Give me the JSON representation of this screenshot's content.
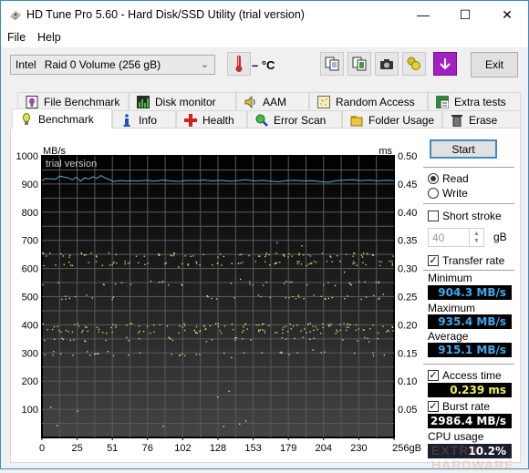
{
  "window": {
    "title": "HD Tune Pro 5.60 - Hard Disk/SSD Utility (trial version)",
    "controls": {
      "minimize": "—",
      "maximize": "☐",
      "close": "✕"
    }
  },
  "menu": {
    "items": [
      "File",
      "Help"
    ]
  },
  "toolbar": {
    "drive_vendor": "Intel",
    "drive_name": "Raid 0 Volume (256 gB)",
    "temperature": "– °C",
    "exit_label": "Exit",
    "icons": [
      "copy-text-icon",
      "copy-screen-icon",
      "screenshot-camera-icon",
      "options-coins-icon",
      "save-download-icon"
    ]
  },
  "tabs": {
    "row1": [
      "File Benchmark",
      "Disk monitor",
      "AAM",
      "Random Access",
      "Extra tests"
    ],
    "row2": [
      "Benchmark",
      "Info",
      "Health",
      "Error Scan",
      "Folder Usage",
      "Erase"
    ],
    "active": "Benchmark"
  },
  "controls": {
    "start_label": "Start",
    "mode_options": [
      "Read",
      "Write"
    ],
    "mode_selected": "Read",
    "short_stroke_label": "Short stroke",
    "short_stroke_checked": false,
    "short_stroke_value": "40",
    "short_stroke_unit": "gB",
    "transfer_rate_label": "Transfer rate",
    "transfer_rate_checked": true,
    "access_time_label": "Access time",
    "access_time_checked": true,
    "burst_rate_label": "Burst rate",
    "burst_rate_checked": true
  },
  "results": {
    "minimum_label": "Minimum",
    "minimum": "904.3 MB/s",
    "maximum_label": "Maximum",
    "maximum": "935.4 MB/s",
    "average_label": "Average",
    "average": "915.1 MB/s",
    "access_time": "0.239 ms",
    "burst_rate": "2986.4 MB/s",
    "cpu_usage_label": "CPU usage",
    "cpu_usage": "10.2%",
    "colors": {
      "transfer": "#4aa8e0",
      "access": "#f0f060",
      "burst": "#ffffff"
    }
  },
  "watermark": "EXTRA HARDWARE",
  "chart_data": {
    "type": "line",
    "title": "",
    "watermark_text": "trial version",
    "xlabel": "gB",
    "ylabel_left": "MB/s",
    "ylabel_right": "ms",
    "x_ticks": [
      "0",
      "25",
      "51",
      "76",
      "102",
      "128",
      "153",
      "179",
      "204",
      "230",
      "256gB"
    ],
    "xlim": [
      0,
      256
    ],
    "y_left_ticks": [
      "1000",
      "900",
      "800",
      "700",
      "600",
      "500",
      "400",
      "300",
      "200",
      "100"
    ],
    "ylim_left": [
      0,
      1000
    ],
    "y_right_ticks": [
      "0.50",
      "0.45",
      "0.40",
      "0.35",
      "0.30",
      "0.25",
      "0.20",
      "0.15",
      "0.10",
      "0.05"
    ],
    "ylim_right": [
      0,
      0.5
    ],
    "grid": true,
    "series": [
      {
        "name": "Transfer rate",
        "kind": "line",
        "x": [
          0,
          3,
          6,
          10,
          13,
          16,
          19,
          22,
          25,
          28,
          31,
          34,
          37,
          40,
          43,
          46,
          49,
          52,
          55,
          58,
          61,
          64,
          70,
          76,
          82,
          88,
          94,
          100,
          106,
          112,
          118,
          124,
          130,
          136,
          142,
          148,
          154,
          160,
          166,
          172,
          178,
          184,
          190,
          196,
          202,
          208,
          214,
          220,
          226,
          232,
          238,
          244,
          250,
          256
        ],
        "values": [
          912,
          920,
          918,
          917,
          928,
          925,
          922,
          915,
          924,
          910,
          922,
          918,
          926,
          920,
          930,
          921,
          916,
          909,
          911,
          913,
          910,
          912,
          911,
          913,
          910,
          914,
          911,
          909,
          913,
          912,
          914,
          911,
          913,
          910,
          912,
          915,
          911,
          913,
          910,
          908,
          912,
          913,
          911,
          912,
          909,
          906,
          912,
          914,
          915,
          912,
          914,
          911,
          913,
          912
        ]
      },
      {
        "name": "Access time",
        "kind": "scatter",
        "units": "ms",
        "bands_ms": [
          0.325,
          0.31,
          0.275,
          0.25,
          0.2,
          0.19,
          0.175,
          0.15
        ],
        "outliers_ms": [
          0.38,
          0.36,
          0.35,
          0.06,
          0.03,
          0.09
        ]
      }
    ]
  }
}
